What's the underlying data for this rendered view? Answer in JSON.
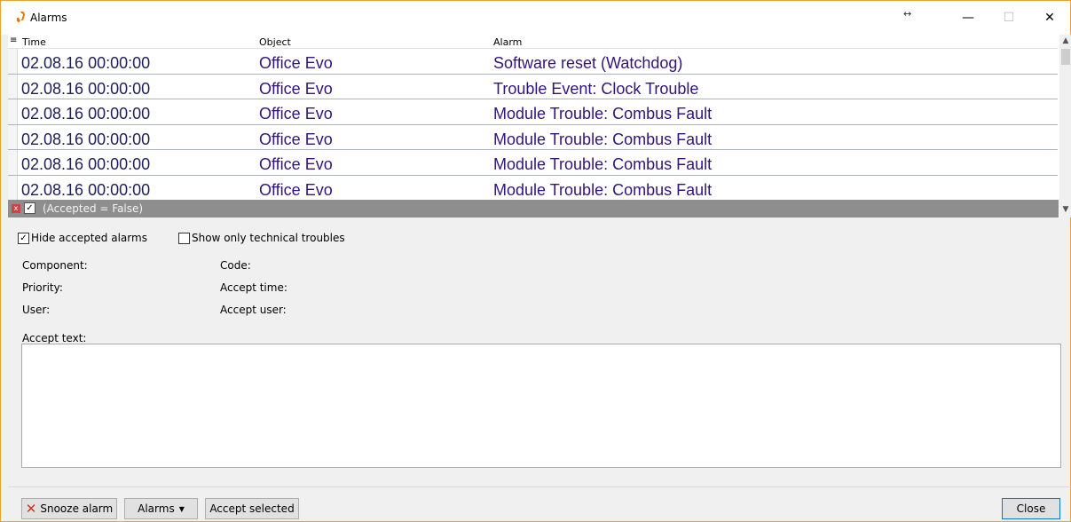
{
  "window": {
    "title": "Alarms"
  },
  "grid": {
    "columns": [
      "Time",
      "Object",
      "Alarm"
    ],
    "rows": [
      {
        "time": "02.08.16 00:00:00",
        "object": "Office Evo",
        "alarm": "Software reset (Watchdog)"
      },
      {
        "time": "02.08.16 00:00:00",
        "object": "Office Evo",
        "alarm": "Trouble Event: Clock Trouble"
      },
      {
        "time": "02.08.16 00:00:00",
        "object": "Office Evo",
        "alarm": "Module Trouble: Combus Fault"
      },
      {
        "time": "02.08.16 00:00:00",
        "object": "Office Evo",
        "alarm": "Module Trouble: Combus Fault"
      },
      {
        "time": "02.08.16 00:00:00",
        "object": "Office Evo",
        "alarm": "Module Trouble: Combus Fault"
      },
      {
        "time": "02.08.16 00:00:00",
        "object": "Office Evo",
        "alarm": "Module Trouble: Combus Fault"
      }
    ],
    "filter_text": "(Accepted = False)"
  },
  "options": {
    "hide_accepted": {
      "label": "Hide accepted alarms",
      "checked": true
    },
    "technical_only": {
      "label": "Show only technical troubles",
      "checked": false
    }
  },
  "details": {
    "component": "Component:",
    "code": "Code:",
    "priority": "Priority:",
    "accept_time": "Accept time:",
    "user": "User:",
    "accept_user": "Accept user:",
    "accept_text": "Accept text:"
  },
  "buttons": {
    "snooze": "Snooze alarm",
    "alarms": "Alarms",
    "accept": "Accept selected",
    "close": "Close"
  }
}
